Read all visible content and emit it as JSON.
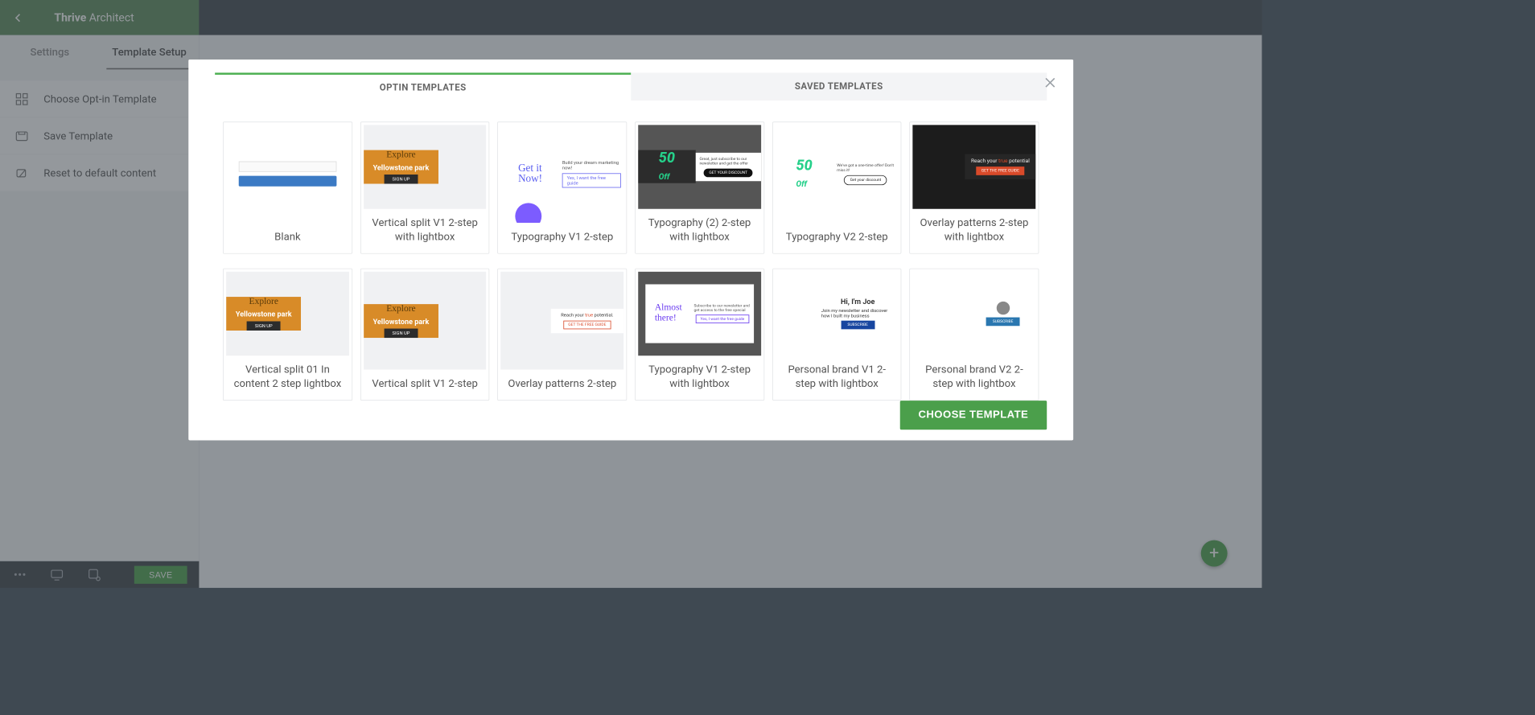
{
  "app": {
    "title_bold": "Thrive",
    "title_light": "Architect"
  },
  "sidebar": {
    "tabs": {
      "settings": "Settings",
      "template_setup": "Template Setup"
    },
    "items": [
      {
        "label": "Choose Opt-in Template"
      },
      {
        "label": "Save Template"
      },
      {
        "label": "Reset to default content"
      }
    ]
  },
  "bottom": {
    "save": "SAVE"
  },
  "modal": {
    "tabs": {
      "optin": "OPTIN TEMPLATES",
      "saved": "SAVED TEMPLATES"
    },
    "choose": "CHOOSE TEMPLATE",
    "templates": [
      {
        "name": "Blank"
      },
      {
        "name": "Vertical split V1 2-step with lightbox"
      },
      {
        "name": "Typography V1 2-step"
      },
      {
        "name": "Typography (2) 2-step with lightbox"
      },
      {
        "name": "Typography V2 2-step"
      },
      {
        "name": "Overlay patterns 2-step with lightbox"
      },
      {
        "name": "Vertical split 01 In content 2 step lightbox"
      },
      {
        "name": "Vertical split V1 2-step"
      },
      {
        "name": "Overlay patterns 2-step"
      },
      {
        "name": "Typography V1 2-step with lightbox"
      },
      {
        "name": "Personal brand V1 2-step with lightbox"
      },
      {
        "name": "Personal brand V2 2-step with lightbox"
      }
    ]
  }
}
